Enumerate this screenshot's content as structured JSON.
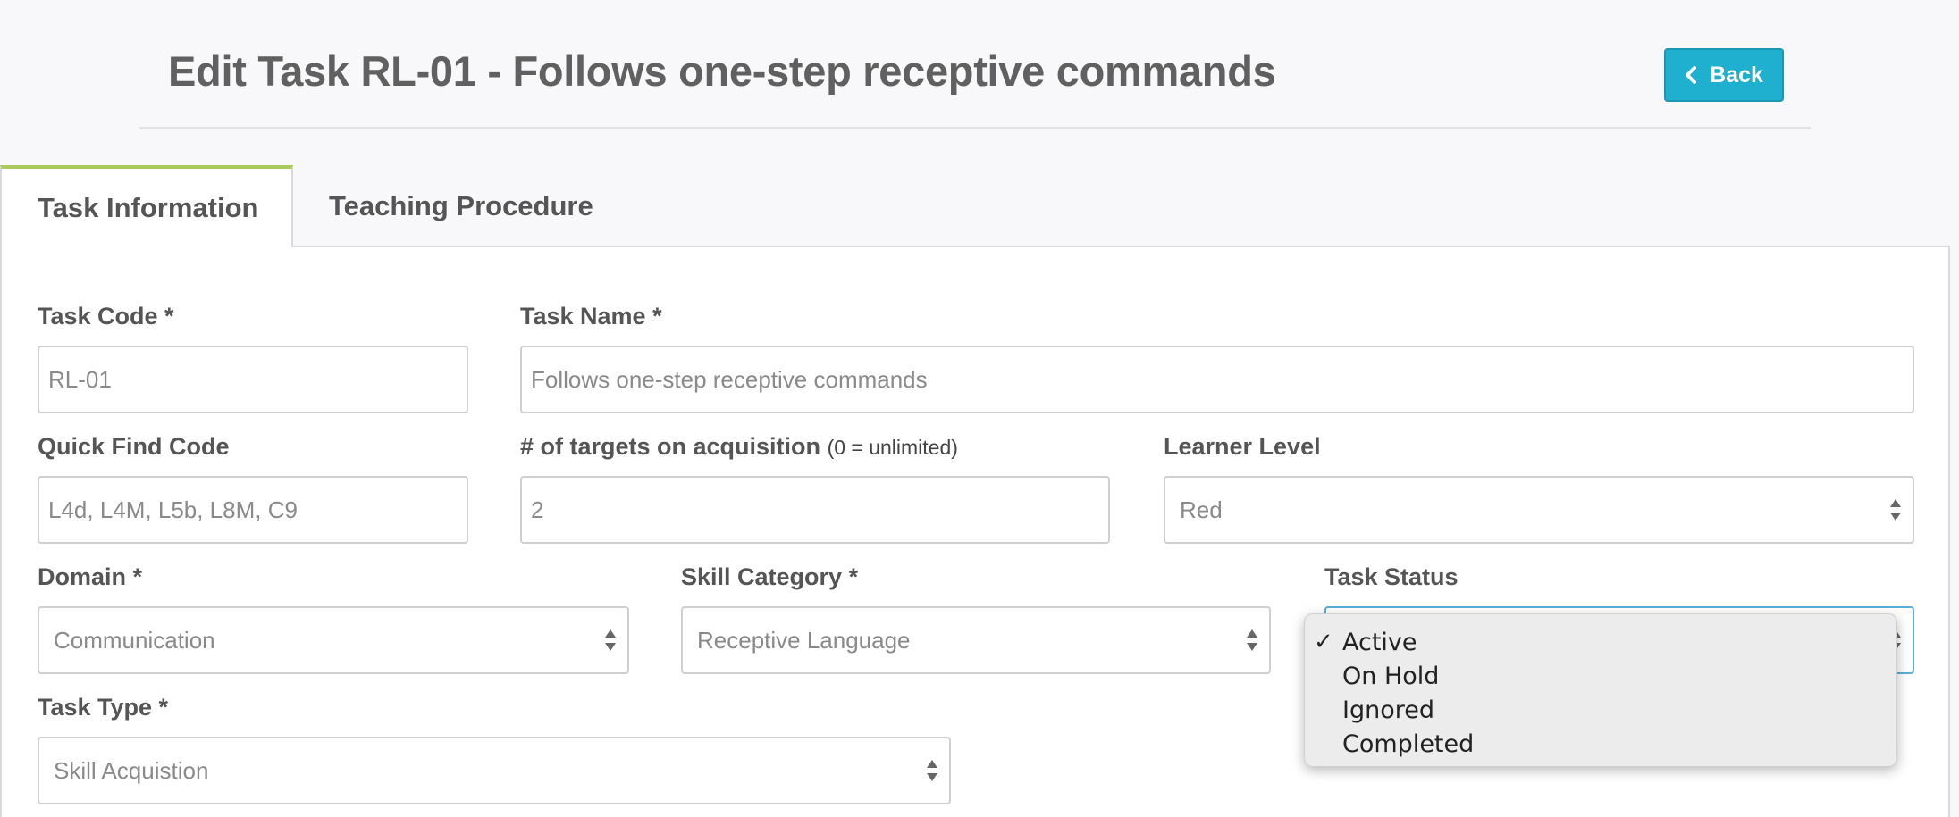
{
  "header": {
    "title": "Edit Task RL-01 - Follows one-step receptive commands",
    "back_label": "Back"
  },
  "tabs": [
    {
      "label": "Task Information",
      "active": true
    },
    {
      "label": "Teaching Procedure",
      "active": false
    }
  ],
  "form": {
    "task_code": {
      "label": "Task Code *",
      "value": "RL-01"
    },
    "task_name": {
      "label": "Task Name *",
      "value": "Follows one-step receptive commands"
    },
    "quick_find": {
      "label": "Quick Find Code",
      "value": "L4d, L4M, L5b, L8M, C9"
    },
    "targets": {
      "label": "# of targets on acquisition",
      "note": "(0 = unlimited)",
      "value": "2"
    },
    "learner_level": {
      "label": "Learner Level",
      "value": "Red"
    },
    "domain": {
      "label": "Domain *",
      "value": "Communication"
    },
    "skill_category": {
      "label": "Skill Category *",
      "value": "Receptive Language"
    },
    "task_status": {
      "label": "Task Status",
      "selected": "Active",
      "options": [
        "Active",
        "On Hold",
        "Ignored",
        "Completed"
      ]
    },
    "task_type": {
      "label": "Task Type *",
      "value": "Skill Acquistion"
    }
  },
  "colors": {
    "accent": "#1fb0cf",
    "tab_indicator": "#a9c95a",
    "focus_border": "#5aaedb"
  },
  "icons": {
    "back": "chevron-left-icon",
    "select": "select-arrows-icon",
    "check": "checkmark-icon"
  }
}
